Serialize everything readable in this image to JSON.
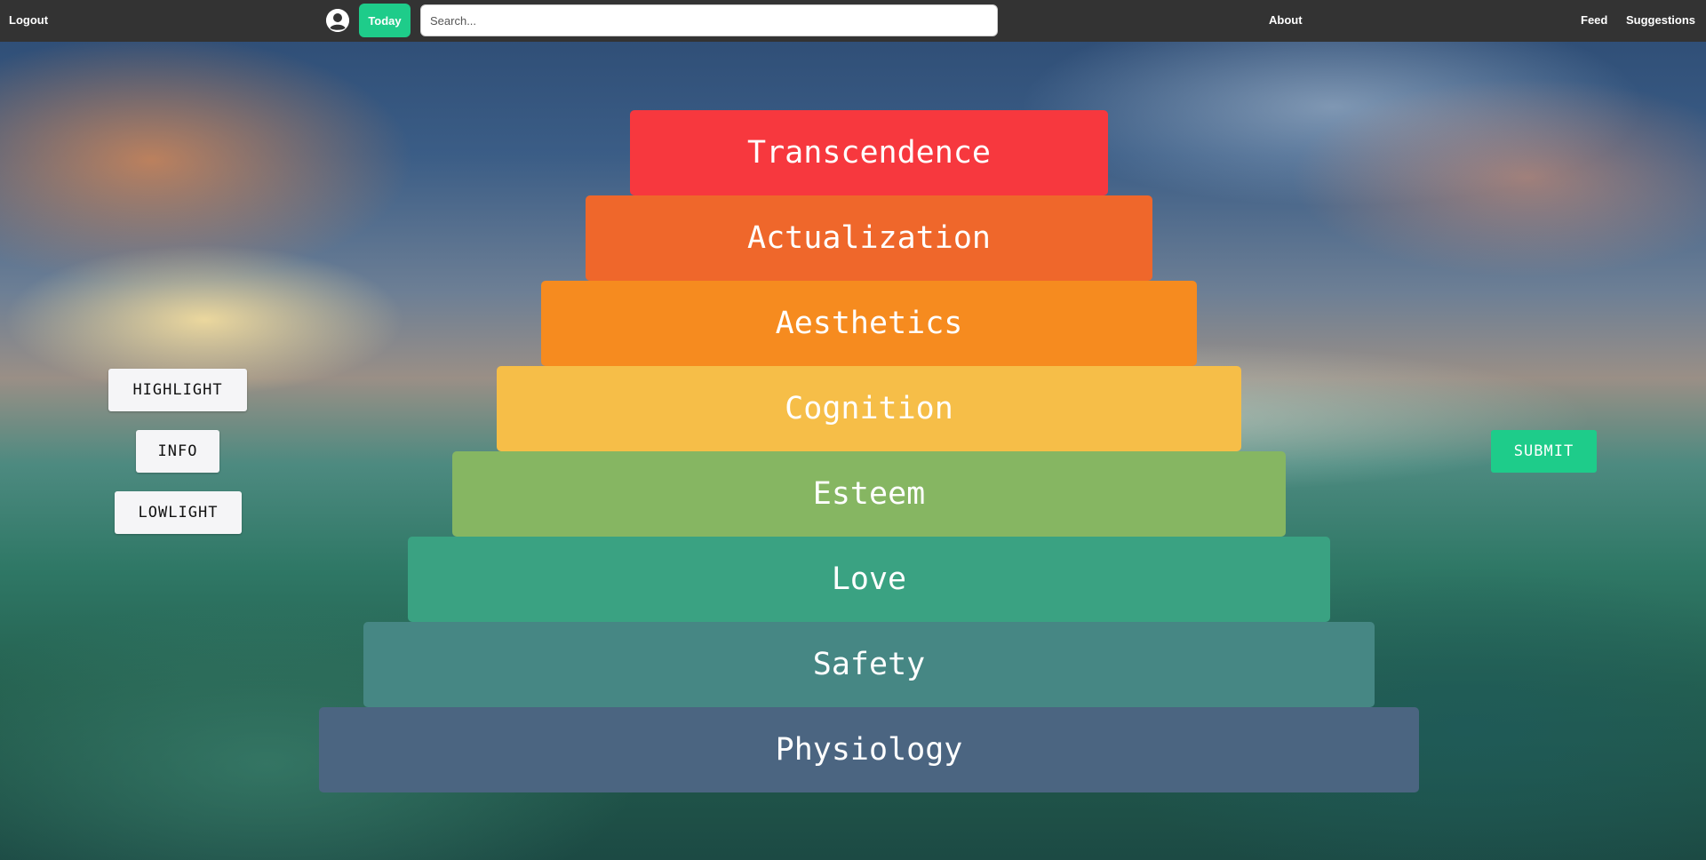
{
  "nav": {
    "logout": "Logout",
    "today": "Today",
    "search_placeholder": "Search...",
    "search_value": "",
    "about": "About",
    "feed": "Feed",
    "suggestions": "Suggestions",
    "avatar_icon": "user-circle-icon"
  },
  "pyramid": {
    "tiers": [
      {
        "label": "Transcendence",
        "color": "#f7383e"
      },
      {
        "label": "Actualization",
        "color": "#ef672b"
      },
      {
        "label": "Aesthetics",
        "color": "#f68b1f"
      },
      {
        "label": "Cognition",
        "color": "#f6be48"
      },
      {
        "label": "Esteem",
        "color": "#86b662"
      },
      {
        "label": "Love",
        "color": "#3aa282"
      },
      {
        "label": "Safety",
        "color": "#468784"
      },
      {
        "label": "Physiology",
        "color": "#4b6581"
      }
    ]
  },
  "actions": {
    "highlight": "HIGHLIGHT",
    "info": "INFO",
    "lowlight": "LOWLIGHT",
    "submit": "SUBMIT"
  },
  "colors": {
    "topbar": "#333333",
    "accent": "#1ecc8a"
  }
}
